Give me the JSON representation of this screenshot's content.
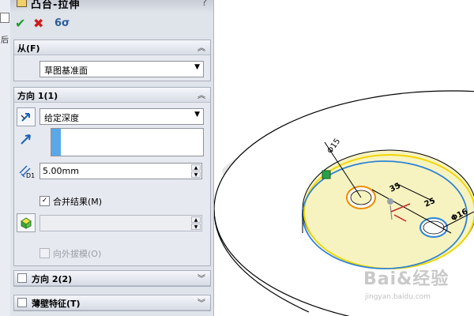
{
  "left_strip": {
    "char": "后"
  },
  "pm": {
    "title": "凸台-拉伸",
    "help": "?",
    "actions": {
      "ok": "✔",
      "cancel": "✖",
      "preview": "6σ"
    }
  },
  "from_group": {
    "title": "从(F)",
    "value": "草图基准面"
  },
  "dir1_group": {
    "title": "方向 1(1)",
    "end_condition": "给定深度",
    "depth": "5.00mm",
    "depth_icon_label": "D1",
    "merge_label": "合并结果(M)",
    "merge_checked": "✓",
    "draft_label": "向外拔模(O)"
  },
  "dir2_group": {
    "title": "方向 2(2)"
  },
  "thin_group": {
    "title": "薄壁特征(T)"
  },
  "dims": {
    "d1": "Φ15",
    "d2": "35",
    "d3": "25",
    "d4": "Φ16"
  },
  "watermark": {
    "text": "Bai&经验",
    "sub": "jingyan.baidu.com"
  }
}
